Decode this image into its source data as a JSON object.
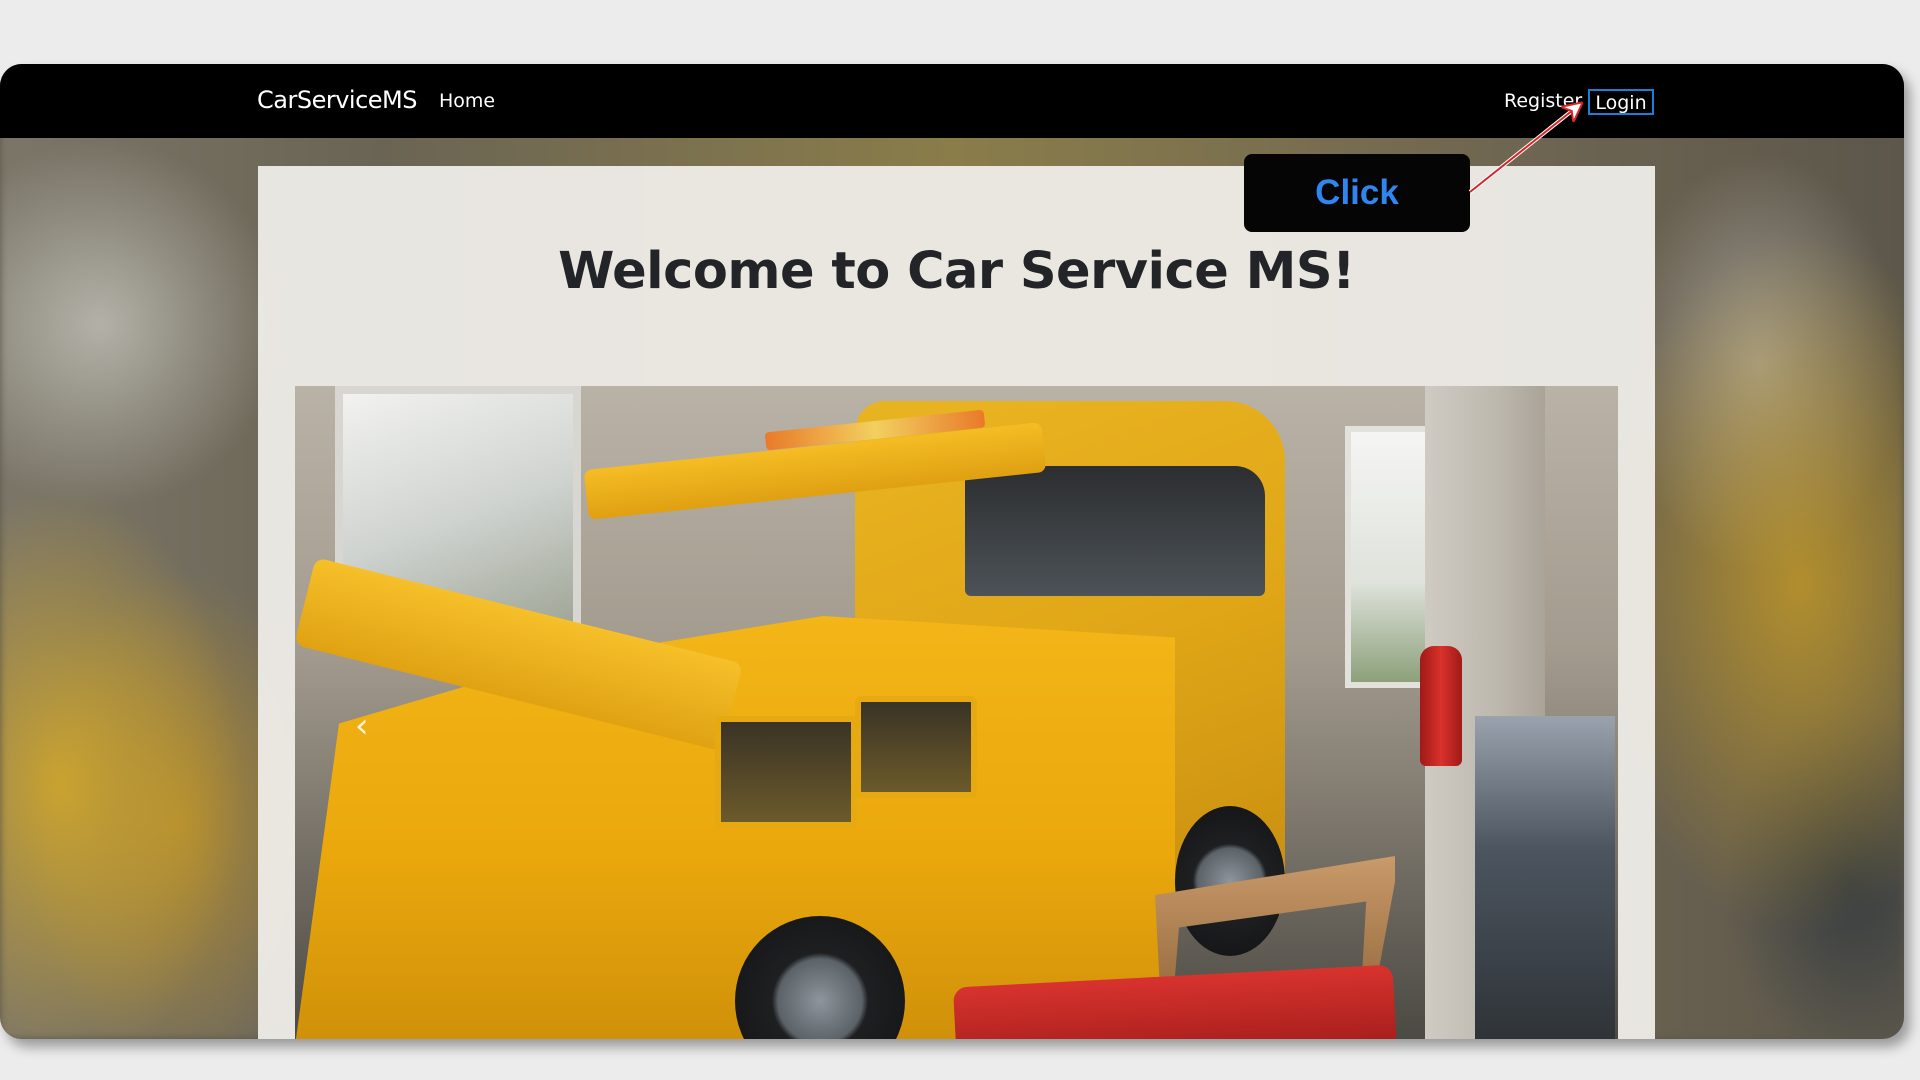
{
  "navbar": {
    "brand": "CarServiceMS",
    "home": "Home",
    "register": "Register",
    "login": "Login"
  },
  "main": {
    "welcome_title": "Welcome to Car Service MS!"
  },
  "carousel": {
    "prev_icon": "chevron-left-icon",
    "prev_glyph": "‹",
    "image_subject": "tow-truck-photo"
  },
  "annotation": {
    "callout_text": "Click",
    "callout_color": "#2f86f0",
    "arrow_color": "#d8262b",
    "highlight_color": "#1a7fd6"
  }
}
